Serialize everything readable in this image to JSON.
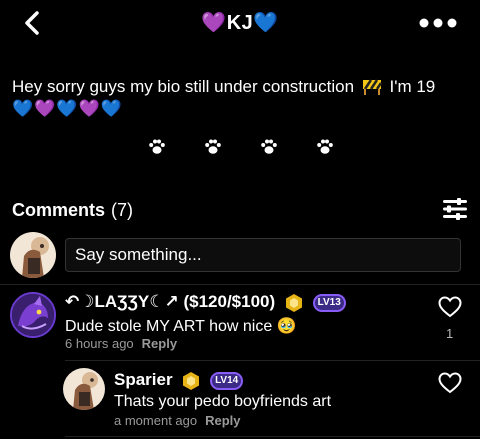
{
  "header": {
    "title_prefix_emoji": "💜",
    "title": "KJ",
    "title_suffix_emoji": "💙"
  },
  "bio": {
    "text": "Hey sorry guys my bio still under construction",
    "text_after_icon": "I'm 19",
    "hearts": "💙💜💙💜💙"
  },
  "comments": {
    "heading": "Comments",
    "count": "(7)",
    "composer_placeholder": "Say something...",
    "items": [
      {
        "author": "↶☽LAƷƷY☾↗ ($120/$100)",
        "level": "LV13",
        "text": "Dude stole MY ART how nice",
        "emoji": "🥹",
        "time": "6 hours ago",
        "reply_label": "Reply",
        "likes": "1"
      },
      {
        "author": "Sparier",
        "level": "LV14",
        "text": "Thats your pedo boyfriends art",
        "time": "a moment ago",
        "reply_label": "Reply"
      }
    ]
  },
  "colors": {
    "background": "#000000",
    "accent_purple": "#8a5cf6",
    "muted": "#9a9a9a"
  }
}
